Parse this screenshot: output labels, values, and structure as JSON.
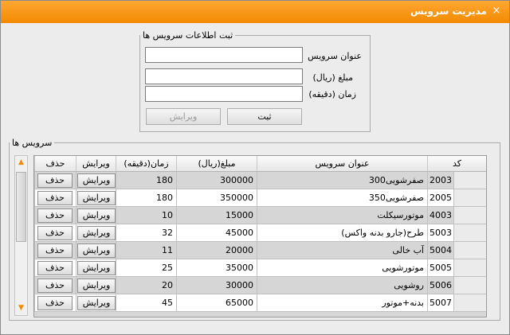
{
  "window": {
    "title": "مدیریت سرویس",
    "close": "×"
  },
  "form": {
    "legend": "ثبت اطلاعات سرویس ها",
    "title_label": "عنوان سرویس",
    "price_label": "مبلغ (ریال)",
    "time_label": "زمان (دقیقه)",
    "title_value": "",
    "price_value": "",
    "time_value": "",
    "submit_label": "ثبت",
    "edit_label": "ویرایش"
  },
  "list": {
    "legend": "سرویس ها",
    "columns": {
      "code": "کد",
      "title": "عنوان سرویس",
      "price": "مبلغ(ریال)",
      "time": "زمان(دقیقه)",
      "edit": "ویرایش",
      "delete": "حذف"
    },
    "edit_button": "ویرایش",
    "delete_button": "حذف",
    "rows": [
      {
        "code": "2003",
        "title": "صفرشویی300",
        "price": "300000",
        "time": "180"
      },
      {
        "code": "2005",
        "title": "صفرشویی350",
        "price": "350000",
        "time": "180"
      },
      {
        "code": "4003",
        "title": "موتورسیکلت",
        "price": "15000",
        "time": "10"
      },
      {
        "code": "5003",
        "title": "طرح(جارو بدنه واکس)",
        "price": "45000",
        "time": "32"
      },
      {
        "code": "5004",
        "title": "آب خالی",
        "price": "20000",
        "time": "11"
      },
      {
        "code": "5005",
        "title": "موتورشویی",
        "price": "35000",
        "time": "25"
      },
      {
        "code": "5006",
        "title": "روشویی",
        "price": "30000",
        "time": "20"
      },
      {
        "code": "5007",
        "title": "بدنه+موتور",
        "price": "65000",
        "time": "45"
      }
    ]
  },
  "colors": {
    "titlebar": "#f28a00",
    "alt_row": "#d6d6d6"
  },
  "icons": {
    "scroll_up": "arrow-up-icon",
    "scroll_down": "arrow-down-icon",
    "close": "close-icon"
  }
}
